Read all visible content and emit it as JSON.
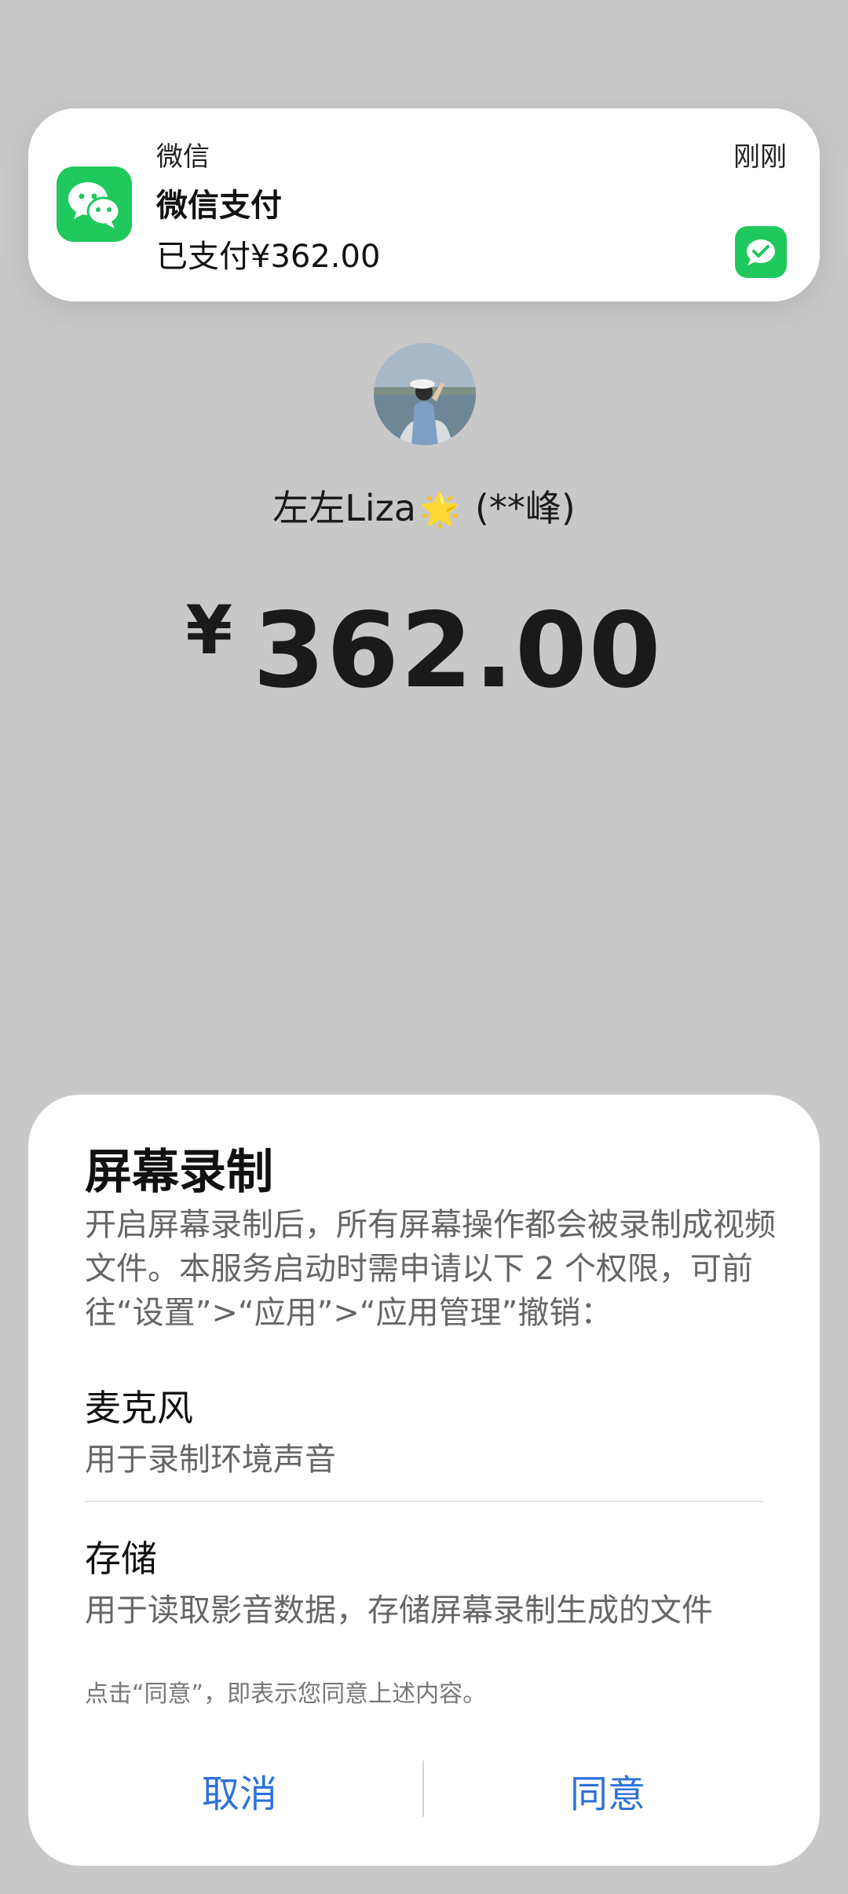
{
  "notification": {
    "app_name": "微信",
    "time": "刚刚",
    "title": "微信支付",
    "body": "已支付¥362.00",
    "app_icon": "wechat-logo-icon",
    "small_icon": "wechat-pay-icon",
    "accent_color": "#1fc95e"
  },
  "payment": {
    "payee_name": "左左Liza",
    "payee_emoji": "🌟",
    "payee_suffix": " (**峰)",
    "currency_symbol": "¥",
    "amount": "362.00"
  },
  "dialog": {
    "title": "屏幕录制",
    "description": "开启屏幕录制后，所有屏幕操作都会被录制成视频文件。本服务启动时需申请以下 2 个权限，可前往“设置”>“应用”>“应用管理”撤销：",
    "permissions": [
      {
        "name": "麦克风",
        "desc": "用于录制环境声音"
      },
      {
        "name": "存储",
        "desc": "用于读取影音数据，存储屏幕录制生成的文件"
      }
    ],
    "note": "点击“同意”，即表示您同意上述内容。",
    "cancel_label": "取消",
    "agree_label": "同意",
    "button_color": "#2f72d8"
  }
}
